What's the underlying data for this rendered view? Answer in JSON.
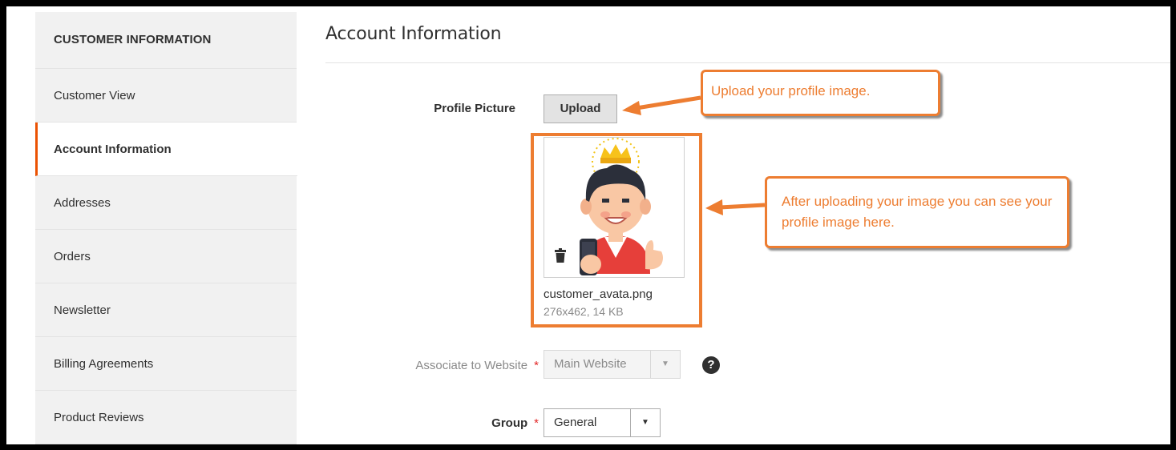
{
  "sidebar": {
    "title": "CUSTOMER INFORMATION",
    "items": [
      {
        "label": "Customer View"
      },
      {
        "label": "Account Information"
      },
      {
        "label": "Addresses"
      },
      {
        "label": "Orders"
      },
      {
        "label": "Newsletter"
      },
      {
        "label": "Billing Agreements"
      },
      {
        "label": "Product Reviews"
      }
    ],
    "active_index": 1
  },
  "main": {
    "title": "Account Information",
    "profile_picture": {
      "label": "Profile Picture",
      "upload_label": "Upload",
      "file_name": "customer_avata.png",
      "file_meta": "276x462, 14 KB"
    },
    "associate_website": {
      "label": "Associate to Website",
      "required_mark": "*",
      "value": "Main Website",
      "help_icon": "?"
    },
    "group": {
      "label": "Group",
      "required_mark": "*",
      "value": "General"
    }
  },
  "callouts": {
    "upload": "Upload your profile image.",
    "preview": "After uploading your image you can see your profile image here."
  },
  "colors": {
    "accent": "#eb5202",
    "callout": "#ed7d31",
    "required": "#e22626"
  },
  "icons": {
    "trash": "trash-icon",
    "help": "help-icon",
    "dropdown": "chevron-down-icon"
  }
}
